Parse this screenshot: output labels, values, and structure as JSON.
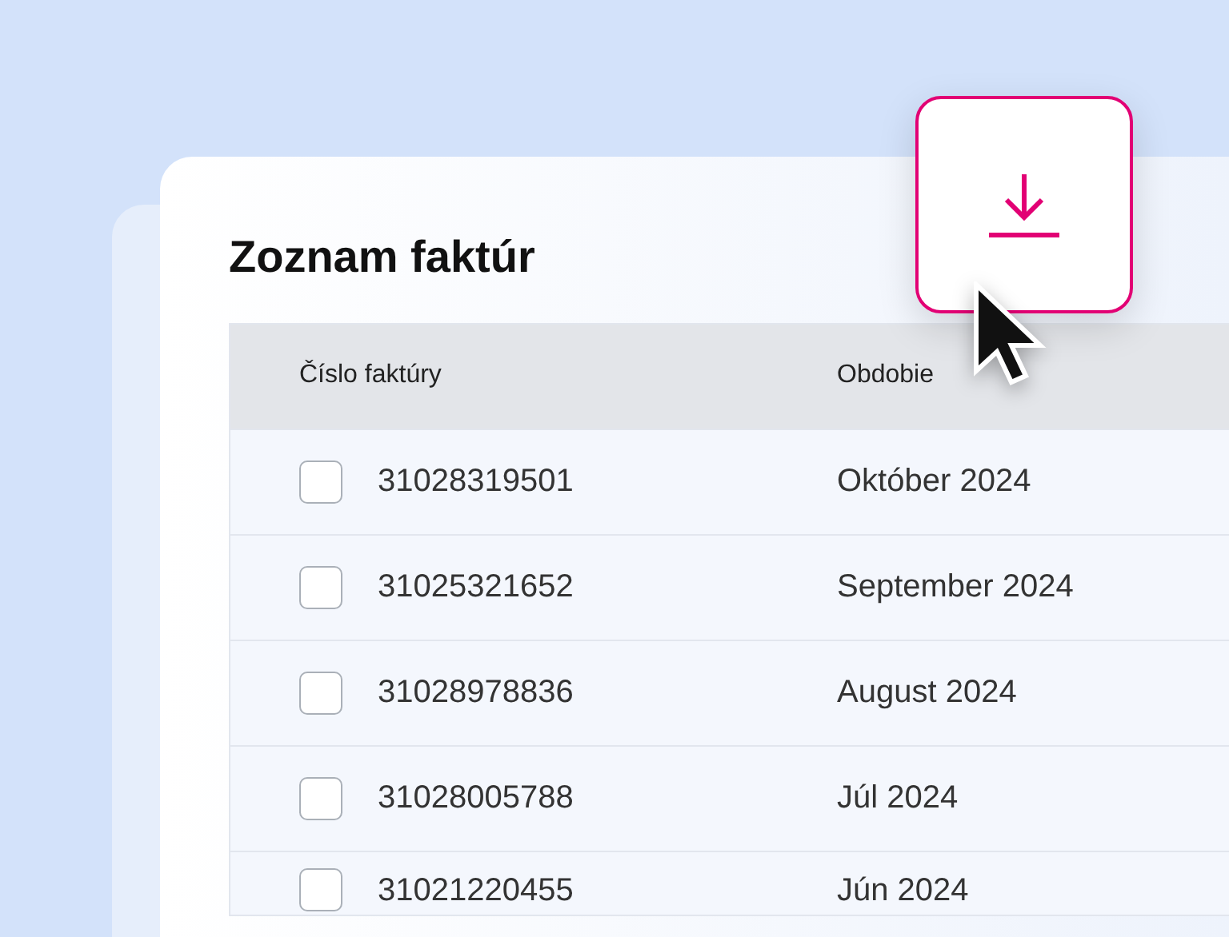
{
  "title": "Zoznam faktúr",
  "table": {
    "columns": [
      "Číslo faktúry",
      "Obdobie"
    ],
    "rows": [
      {
        "checked": false,
        "cells": [
          "31028319501",
          "Október 2024"
        ]
      },
      {
        "checked": false,
        "cells": [
          "31025321652",
          "September 2024"
        ]
      },
      {
        "checked": false,
        "cells": [
          "31028978836",
          "August 2024"
        ]
      },
      {
        "checked": false,
        "cells": [
          "31028005788",
          "Júl 2024"
        ]
      },
      {
        "checked": false,
        "cells": [
          "31021220455",
          "Jún 2024"
        ]
      }
    ]
  }
}
